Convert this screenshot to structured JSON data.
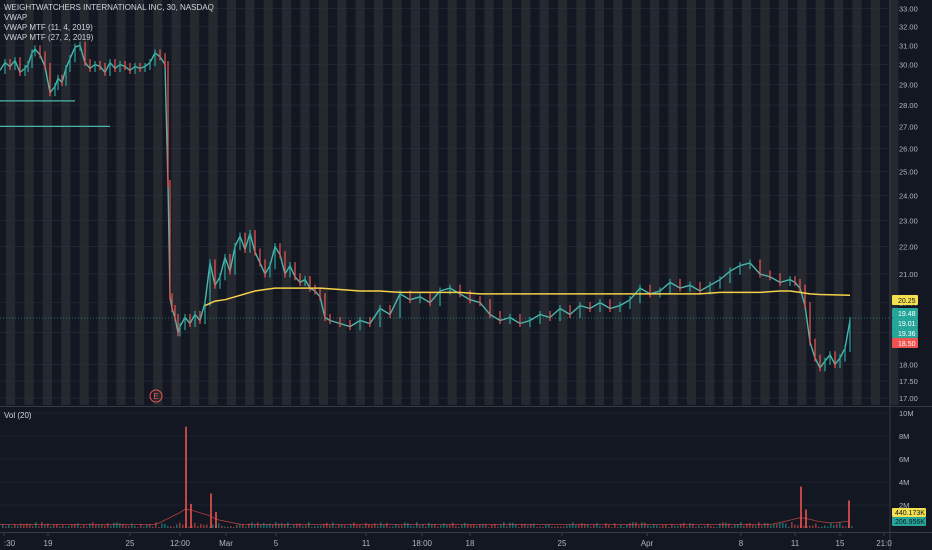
{
  "chart": {
    "title": "WEIGHTWATCHERS INTERNATIONAL INC, 30, NASDAQ",
    "indicators": [
      "VWAP",
      "VWAP MTF (11, 4, 2019)",
      "VWAP MTF (27, 2, 2019)"
    ],
    "volume_label": "Vol (20)",
    "earnings_marker": "E",
    "price_badges": [
      {
        "text": "20.25",
        "color": "#f5e050",
        "value": 20.25
      },
      {
        "text": "19.48",
        "color": "#26a69a",
        "value": 19.48
      },
      {
        "text": "19.01",
        "color": "#26a69a",
        "value": 19.01
      },
      {
        "text": "19.36",
        "color": "#26a69a",
        "value": 19.36
      },
      {
        "text": "18.50",
        "color": "#ef5350",
        "value": 18.5
      }
    ],
    "volume_badges": [
      {
        "text": "440.173K",
        "color": "#f5e050"
      },
      {
        "text": "206.956K",
        "color": "#26a69a"
      }
    ],
    "colors": {
      "background": "#131722",
      "session_band": "#2a2c33",
      "price_line": "#4db6ac",
      "vwap": "#f5d04a",
      "up": "#26a69a",
      "down": "#ef5350"
    }
  },
  "chart_data": {
    "type": "line",
    "title": "WEIGHTWATCHERS INTERNATIONAL INC, 30, NASDAQ",
    "xlabel": "",
    "ylabel": "",
    "x_tick_labels": [
      ":30",
      "19",
      "25",
      "12:00",
      "Mar",
      "5",
      "11",
      "18:00",
      "18",
      "25",
      "Apr",
      "8",
      "11",
      "15",
      "21:0"
    ],
    "y_tick_labels": [
      "33.00",
      "32.00",
      "31.00",
      "30.00",
      "29.00",
      "28.00",
      "27.00",
      "26.00",
      "25.00",
      "24.00",
      "23.00",
      "22.00",
      "21.00",
      "20.00",
      "19.00",
      "18.00",
      "17.50",
      "17.00"
    ],
    "ylim": [
      16.8,
      33.2
    ],
    "log_scale": true,
    "grid": true,
    "volume_y_tick_labels": [
      "10M",
      "8M",
      "6M",
      "4M",
      "2M"
    ],
    "volume_ylim": [
      0,
      10000000
    ],
    "series": [
      {
        "name": "WEIGHTWATCHERS INTERNATIONAL INC, 30, NASDAQ",
        "x": [
          0,
          5,
          10,
          15,
          20,
          25,
          28,
          32,
          35,
          40,
          45,
          50,
          55,
          58,
          62,
          66,
          70,
          75,
          80,
          85,
          90,
          95,
          100,
          105,
          110,
          115,
          120,
          125,
          130,
          135,
          140,
          145,
          150,
          155,
          160,
          165,
          168,
          170,
          172,
          175,
          178,
          180,
          185,
          190,
          195,
          200,
          205,
          210,
          215,
          220,
          225,
          230,
          235,
          240,
          245,
          250,
          255,
          260,
          265,
          270,
          275,
          280,
          285,
          290,
          295,
          300,
          305,
          310,
          315,
          320,
          325,
          330,
          340,
          350,
          360,
          370,
          380,
          390,
          400,
          410,
          420,
          430,
          440,
          450,
          460,
          470,
          480,
          490,
          500,
          510,
          520,
          530,
          540,
          550,
          560,
          570,
          580,
          590,
          600,
          610,
          620,
          630,
          640,
          650,
          660,
          670,
          680,
          690,
          700,
          710,
          720,
          730,
          740,
          750,
          760,
          770,
          780,
          790,
          795,
          800,
          805,
          810,
          815,
          820,
          825,
          830,
          835,
          840,
          845,
          850
        ],
        "y": [
          29.7,
          30.1,
          29.9,
          30.2,
          29.6,
          29.8,
          30.0,
          30.6,
          30.8,
          30.5,
          29.9,
          28.6,
          28.9,
          29.3,
          29.1,
          29.8,
          30.3,
          30.9,
          31.0,
          30.1,
          29.8,
          30.0,
          29.9,
          29.6,
          30.1,
          29.8,
          30.0,
          29.9,
          29.7,
          29.9,
          29.8,
          29.9,
          30.1,
          30.6,
          30.4,
          30.0,
          24.5,
          20.2,
          19.8,
          19.5,
          19.0,
          19.2,
          19.5,
          19.3,
          19.6,
          19.4,
          20.0,
          21.4,
          20.6,
          20.9,
          21.6,
          21.1,
          22.0,
          22.4,
          21.9,
          22.5,
          21.8,
          21.4,
          21.0,
          21.3,
          22.0,
          21.7,
          21.0,
          21.3,
          20.9,
          20.7,
          20.8,
          20.5,
          20.4,
          20.2,
          19.5,
          19.4,
          19.3,
          19.2,
          19.4,
          19.3,
          19.8,
          19.6,
          20.3,
          20.1,
          20.2,
          20.0,
          20.4,
          20.5,
          20.3,
          20.1,
          20.0,
          19.6,
          19.4,
          19.5,
          19.3,
          19.4,
          19.6,
          19.5,
          19.8,
          19.6,
          19.9,
          19.8,
          20.0,
          19.8,
          19.9,
          20.1,
          20.5,
          20.3,
          20.4,
          20.7,
          20.5,
          20.6,
          20.4,
          20.6,
          20.8,
          21.1,
          21.3,
          21.4,
          21.0,
          20.9,
          20.7,
          20.8,
          20.7,
          20.5,
          19.9,
          18.7,
          18.2,
          17.9,
          18.1,
          18.3,
          18.0,
          18.2,
          18.5,
          19.4
        ]
      },
      {
        "name": "VWAP",
        "x": [
          205,
          215,
          225,
          235,
          245,
          255,
          265,
          275,
          285,
          300,
          320,
          340,
          360,
          380,
          400,
          420,
          440,
          460,
          480,
          500,
          520,
          540,
          560,
          580,
          600,
          620,
          640,
          660,
          680,
          700,
          720,
          740,
          760,
          780,
          790,
          800,
          810,
          820,
          830,
          840,
          850
        ],
        "y": [
          19.9,
          20.05,
          20.1,
          20.2,
          20.3,
          20.4,
          20.45,
          20.5,
          20.5,
          20.5,
          20.5,
          20.45,
          20.4,
          20.4,
          20.35,
          20.35,
          20.35,
          20.35,
          20.3,
          20.3,
          20.3,
          20.3,
          20.3,
          20.3,
          20.3,
          20.3,
          20.3,
          20.3,
          20.3,
          20.3,
          20.35,
          20.35,
          20.35,
          20.4,
          20.4,
          20.35,
          20.3,
          20.28,
          20.27,
          20.26,
          20.25
        ]
      }
    ],
    "volume": {
      "name": "Vol (20)",
      "spikes": [
        {
          "x": 185,
          "value": 8800000
        },
        {
          "x": 190,
          "value": 2100000
        },
        {
          "x": 210,
          "value": 3000000
        },
        {
          "x": 215,
          "value": 1400000
        },
        {
          "x": 800,
          "value": 3600000
        },
        {
          "x": 805,
          "value": 1600000
        },
        {
          "x": 848,
          "value": 2400000
        }
      ]
    }
  }
}
